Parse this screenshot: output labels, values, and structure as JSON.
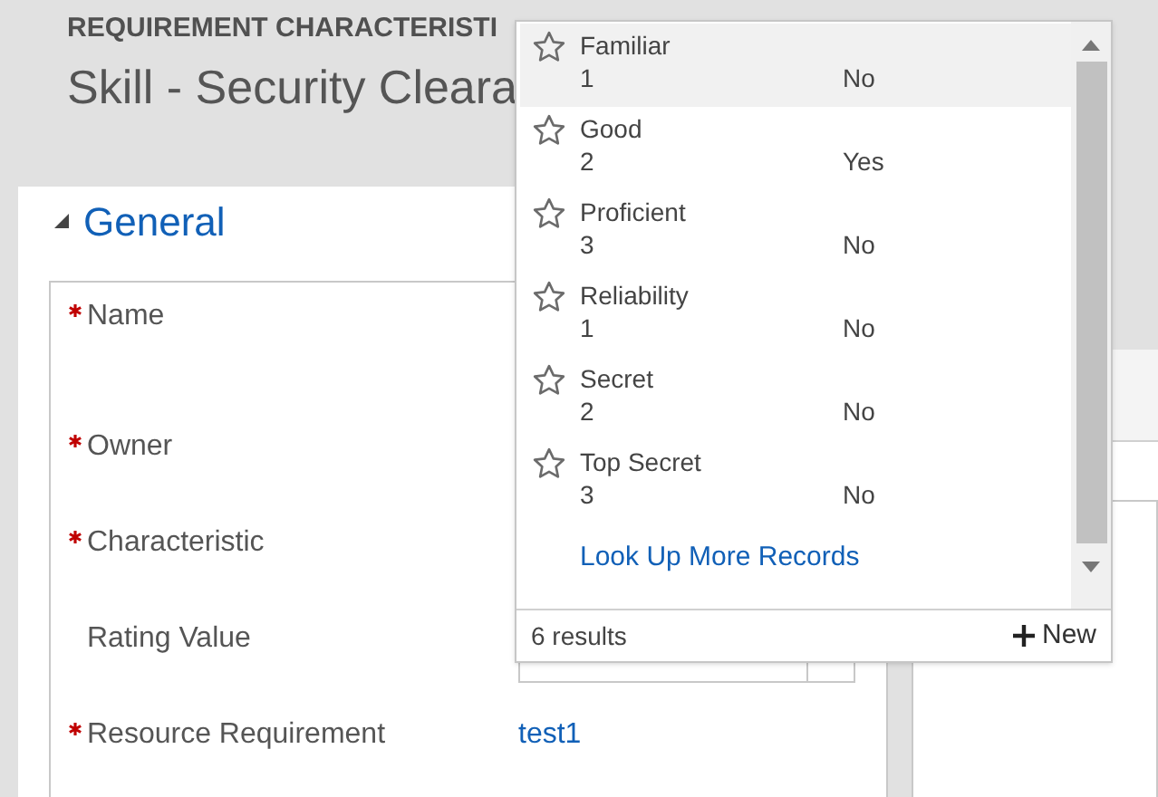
{
  "header": {
    "entity": "REQUIREMENT CHARACTERISTI",
    "title": "Skill - Security Cleara"
  },
  "section": {
    "title": "General",
    "expanded": true
  },
  "fields": [
    {
      "label": "Name",
      "required": true
    },
    {
      "label": "Owner",
      "required": true
    },
    {
      "label": "Characteristic",
      "required": true
    },
    {
      "label": "Rating Value",
      "required": false
    },
    {
      "label": "Resource Requirement",
      "required": true,
      "value": "test1"
    }
  ],
  "lookup": {
    "results": [
      {
        "name": "Familiar",
        "value": "1",
        "default": "No",
        "selected": true
      },
      {
        "name": "Good",
        "value": "2",
        "default": "Yes",
        "selected": false
      },
      {
        "name": "Proficient",
        "value": "3",
        "default": "No",
        "selected": false
      },
      {
        "name": "Reliability",
        "value": "1",
        "default": "No",
        "selected": false
      },
      {
        "name": "Secret",
        "value": "2",
        "default": "No",
        "selected": false
      },
      {
        "name": "Top Secret",
        "value": "3",
        "default": "No",
        "selected": false
      }
    ],
    "more_link": "Look Up More Records",
    "count": "6 results",
    "new_button": "New"
  }
}
